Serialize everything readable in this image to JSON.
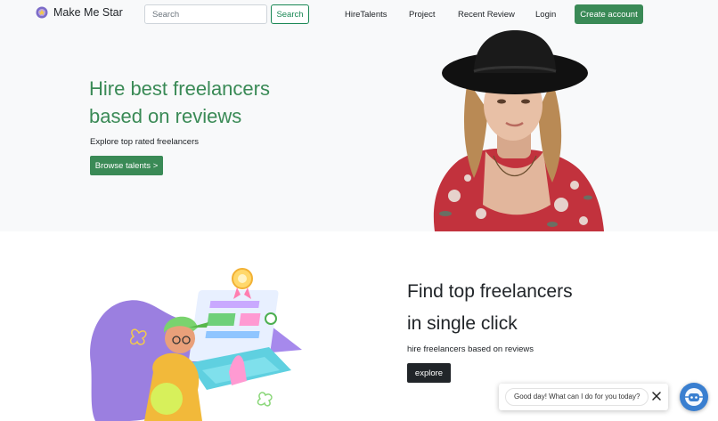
{
  "brand": {
    "name": "Make Me Star",
    "logo_icon": "star-badge-icon"
  },
  "search": {
    "placeholder": "Search",
    "button_label": "Search"
  },
  "nav": {
    "links": [
      {
        "label": "HireTalents"
      },
      {
        "label": "Project"
      },
      {
        "label": "Recent Review"
      },
      {
        "label": "Login"
      }
    ],
    "create_account_label": "Create account"
  },
  "hero": {
    "title_line1": "Hire best freelancers",
    "title_line2": "based on reviews",
    "subtitle": "Explore top rated freelancers",
    "cta_label": "Browse talents >"
  },
  "section2": {
    "title_line1": "Find top freelancers",
    "title_line2": "in single click",
    "subtitle": "hire freelancers based on reviews",
    "cta_label": "explore"
  },
  "chat": {
    "message": "Good day! What can I do for you today?",
    "close_icon": "close-icon",
    "launcher_icon": "chat-bot-icon"
  },
  "colors": {
    "accent_green": "#3a8a56",
    "outline_green": "#198754",
    "dark_button": "#212529",
    "hero_background": "#f8f9fa",
    "chat_launcher": "#3a7fd0"
  }
}
